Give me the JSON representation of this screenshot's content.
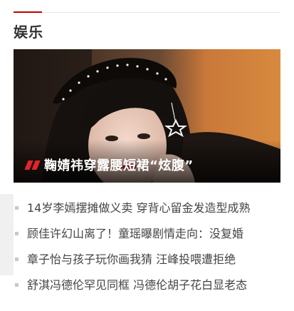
{
  "section": {
    "title": "娱乐"
  },
  "hero": {
    "caption": "鞠婧祎穿露腰短裙“炫腹”",
    "image_alt": "鞠婧祎照片",
    "accent_color": "#e0252b"
  },
  "news": {
    "items": [
      "14岁李嫣摆摊做义卖 穿背心留金发造型成熟",
      "顾佳许幻山离了！童瑶曝剧情走向：没复婚",
      "章子怡与孩子玩你画我猜 汪峰投喂遭拒绝",
      "舒淇冯德伦罕见同框 冯德伦胡子花白显老态"
    ]
  },
  "colors": {
    "title_text": "#333333",
    "link_text": "#444444",
    "divider": "#e6e6e6",
    "divider_accent": "#c40000",
    "bullet": "#c8c8c8"
  }
}
